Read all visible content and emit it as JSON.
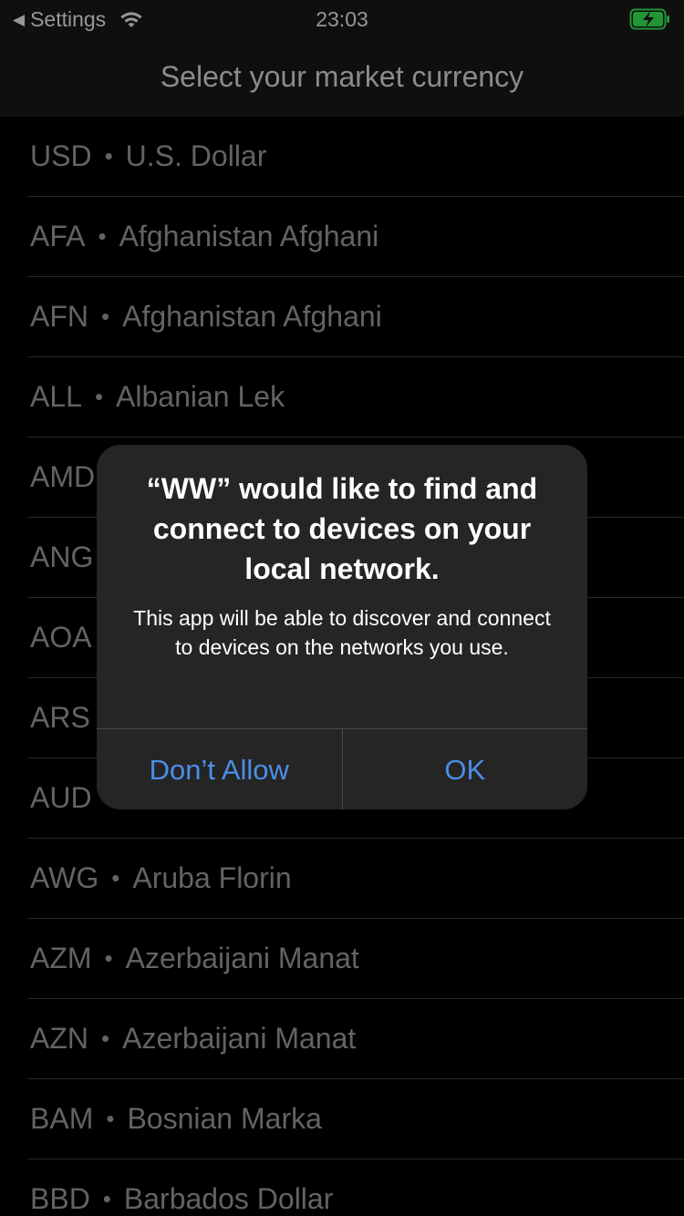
{
  "status_bar": {
    "back_label": "Settings",
    "time": "23:03",
    "battery_color": "#32d74b"
  },
  "nav": {
    "title": "Select your market currency"
  },
  "currencies": [
    {
      "code": "USD",
      "name": "U.S. Dollar"
    },
    {
      "code": "AFA",
      "name": "Afghanistan Afghani"
    },
    {
      "code": "AFN",
      "name": "Afghanistan Afghani"
    },
    {
      "code": "ALL",
      "name": "Albanian Lek"
    },
    {
      "code": "AMD",
      "name": ""
    },
    {
      "code": "ANG",
      "name": ""
    },
    {
      "code": "AOA",
      "name": ""
    },
    {
      "code": "ARS",
      "name": ""
    },
    {
      "code": "AUD",
      "name": ""
    },
    {
      "code": "AWG",
      "name": "Aruba Florin"
    },
    {
      "code": "AZM",
      "name": "Azerbaijani Manat"
    },
    {
      "code": "AZN",
      "name": "Azerbaijani Manat"
    },
    {
      "code": "BAM",
      "name": "Bosnian Marka"
    },
    {
      "code": "BBD",
      "name": "Barbados Dollar"
    }
  ],
  "alert": {
    "title": "“WW” would like to find and connect to devices on your local network.",
    "message": "This app will be able to discover and connect to devices on the networks you use.",
    "deny_label": "Don’t Allow",
    "ok_label": "OK",
    "button_color": "#4a8fe7"
  },
  "icons": {
    "back": "back-triangle-icon",
    "wifi": "wifi-icon",
    "battery": "battery-charging-icon"
  }
}
